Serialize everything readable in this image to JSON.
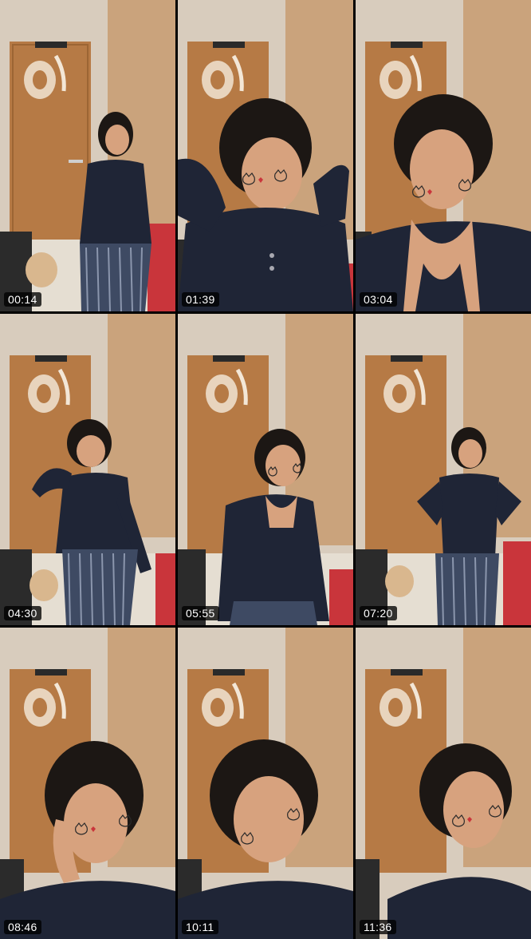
{
  "grid": {
    "columns": 3,
    "rows": 3,
    "items": [
      {
        "timestamp": "00:14",
        "pose": "standing-far"
      },
      {
        "timestamp": "01:39",
        "pose": "closeup-hand-up"
      },
      {
        "timestamp": "03:04",
        "pose": "closeup"
      },
      {
        "timestamp": "04:30",
        "pose": "standing-arm-up"
      },
      {
        "timestamp": "05:55",
        "pose": "standing-mid"
      },
      {
        "timestamp": "07:20",
        "pose": "standing-hands-hips"
      },
      {
        "timestamp": "08:46",
        "pose": "closeup-hand-up"
      },
      {
        "timestamp": "10:11",
        "pose": "closeup"
      },
      {
        "timestamp": "11:36",
        "pose": "closeup"
      }
    ]
  },
  "colors": {
    "wall": "#d9cdbf",
    "door": "#b67a45",
    "top": "#1f2536",
    "skirt": "#3e4a63",
    "hair": "#1c1714",
    "skin": "#d7a27e",
    "timestamp_bg": "#000000"
  },
  "icons": [
    "cat-face-sticker",
    "heart-sticker",
    "potty-seat",
    "door",
    "stroller"
  ]
}
